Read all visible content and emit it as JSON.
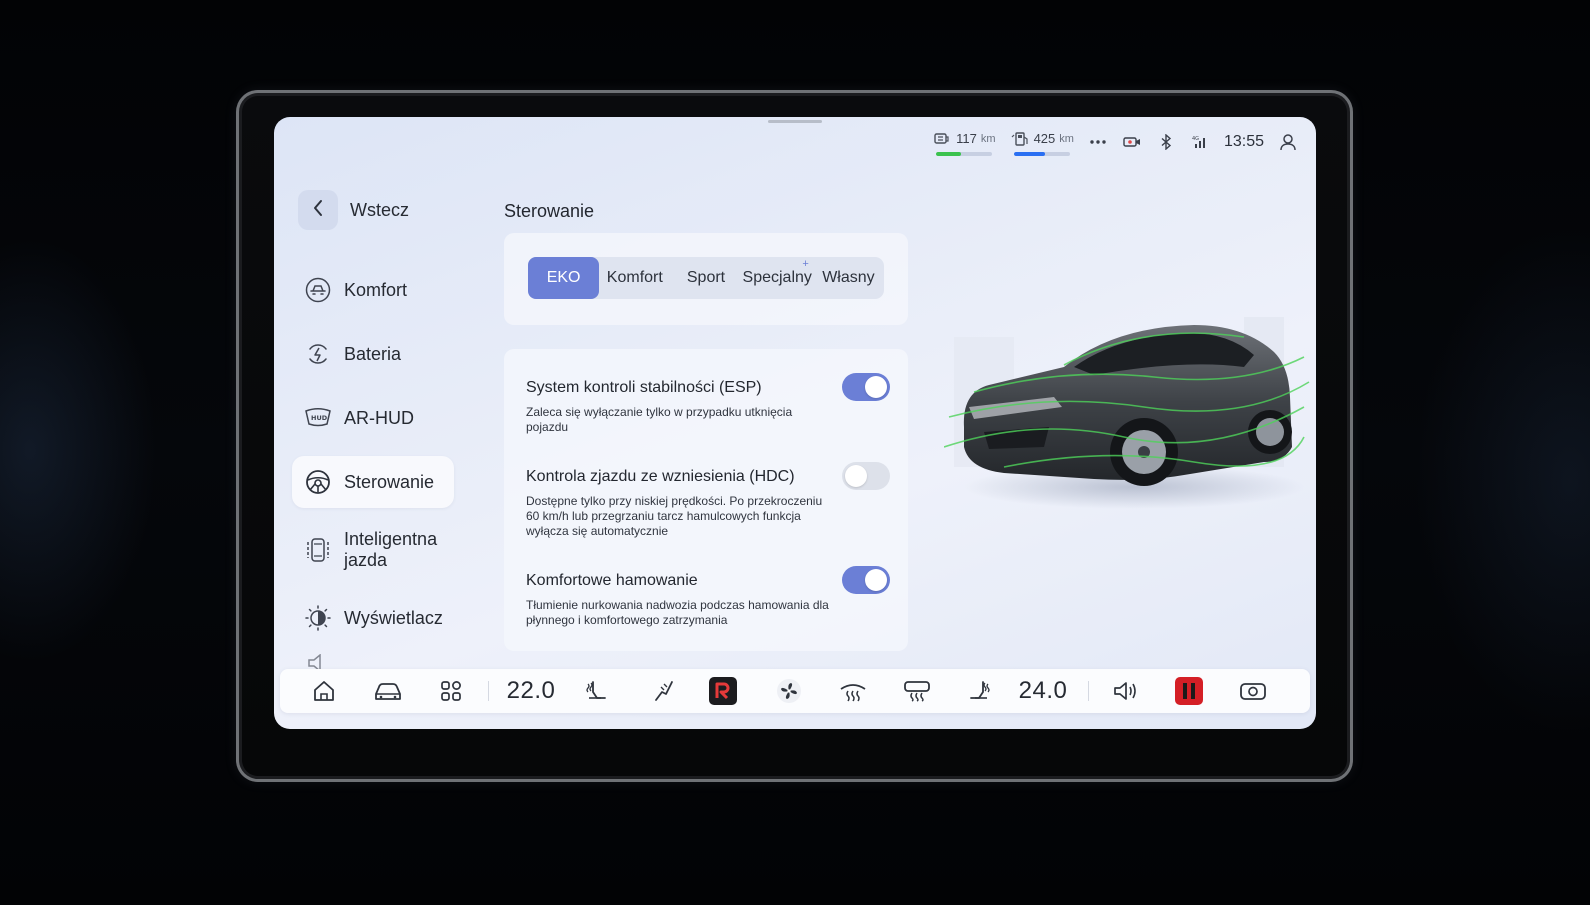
{
  "status_bar": {
    "range_electric": {
      "value": "117",
      "unit": "km",
      "level": 0.45,
      "color": "#3bc24e"
    },
    "range_fuel": {
      "value": "425",
      "unit": "km",
      "level": 0.55,
      "color": "#2a6ff2"
    },
    "more_icon": "more-dots-icon",
    "record_icon": "dashcam-icon",
    "bluetooth_icon": "bluetooth-icon",
    "signal_icon": "signal-4g-icon",
    "time": "13:55",
    "profile_icon": "user-icon"
  },
  "sidebar": {
    "back_label": "Wstecz",
    "items": [
      {
        "label": "Komfort",
        "icon": "seat-comfort-icon",
        "active": false
      },
      {
        "label": "Bateria",
        "icon": "battery-charge-icon",
        "active": false
      },
      {
        "label": "AR-HUD",
        "icon": "hud-icon",
        "active": false
      },
      {
        "label": "Sterowanie",
        "icon": "steering-wheel-icon",
        "active": true
      },
      {
        "label": "Inteligentna jazda",
        "icon": "smart-driving-icon",
        "active": false
      },
      {
        "label": "Wyświetlacz",
        "icon": "brightness-icon",
        "active": false
      }
    ]
  },
  "main": {
    "section_title": "Sterowanie",
    "modes": [
      {
        "label": "EKO",
        "active": true
      },
      {
        "label": "Komfort",
        "active": false
      },
      {
        "label": "Sport",
        "active": false
      },
      {
        "label": "Specjalny",
        "active": false,
        "plus": "+"
      },
      {
        "label": "Własny",
        "active": false
      }
    ],
    "settings": [
      {
        "title": "System kontroli stabilności (ESP)",
        "description": "Zaleca się wyłączanie tylko w przypadku utknięcia pojazdu",
        "enabled": true
      },
      {
        "title": "Kontrola zjazdu ze wzniesienia (HDC)",
        "description": "Dostępne tylko przy niskiej prędkości. Po przekroczeniu 60 km/h lub przegrzaniu tarcz hamulcowych funkcja wyłącza się automatycznie",
        "enabled": false
      },
      {
        "title": "Komfortowe hamowanie",
        "description": "Tłumienie nurkowania nadwozia podczas hamowania dla płynnego i komfortowego zatrzymania",
        "enabled": true
      }
    ]
  },
  "dock": {
    "temp_left": "22.0",
    "temp_right": "24.0",
    "accent_red": "#d41f26",
    "icons": [
      "home-icon",
      "car-icon",
      "apps-grid-icon",
      "seat-heat-left-icon",
      "seat-massage-icon",
      "r-app-icon",
      "fan-icon",
      "front-defrost-icon",
      "rear-defrost-icon",
      "seat-heat-right-icon",
      "volume-icon",
      "red-app-icon",
      "camera-icon"
    ]
  },
  "colors": {
    "accent": "#6b7fd6",
    "screen_bg": "#e7ecf8"
  }
}
